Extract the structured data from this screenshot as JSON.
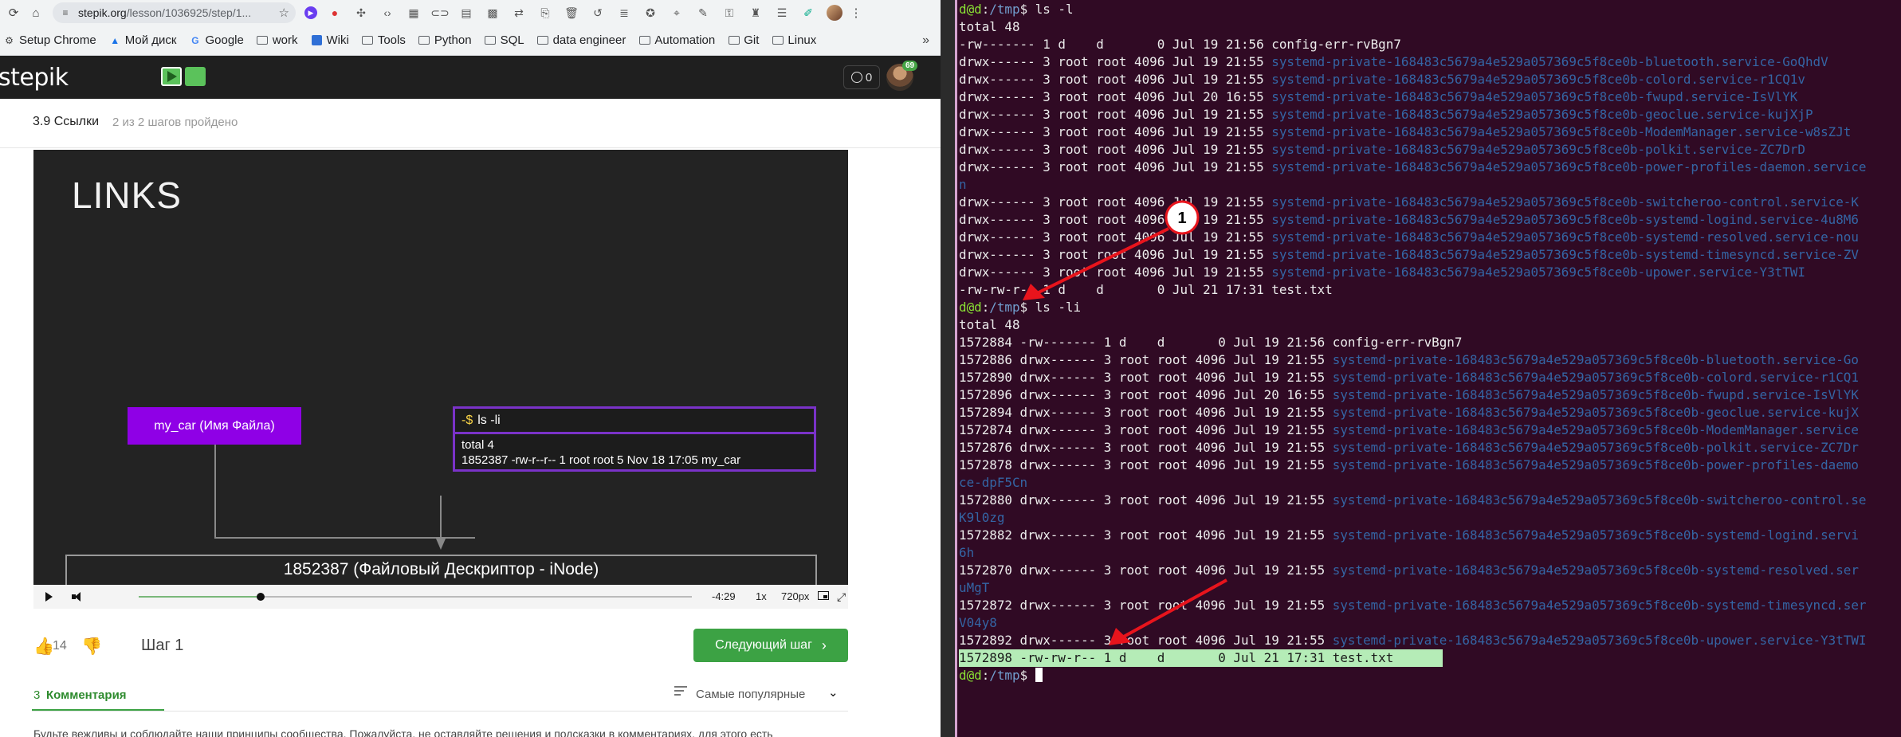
{
  "browser": {
    "url_host": "stepik.org",
    "url_path": "/lesson/1036925/step/1...",
    "bookmarks": [
      "Setup Chrome",
      "Мой диск",
      "Google",
      "work",
      "Wiki",
      "Tools",
      "Python",
      "SQL",
      "data engineer",
      "Automation",
      "Git",
      "Linux"
    ],
    "more_label": "»"
  },
  "stepik": {
    "logo": "stepik",
    "notifications": "0",
    "avatar_badge": "69",
    "lesson_title": "3.9 Ссылки",
    "lesson_steps": "2 из 2 шагов пройдено"
  },
  "video": {
    "slide_title": "LINKS",
    "filename_label": "my_car (Имя Файла)",
    "term_prompt": "-$",
    "term_command": "ls  -li",
    "term_output": [
      "total 4",
      "1852387 -rw-r--r-- 1 root root 5 Nov 18 17:05 my_car"
    ],
    "inode_label": "1852387 (Файловый Дескриптор - iNode)",
    "controls": {
      "time": "-4:29",
      "rate": "1x",
      "quality": "720px",
      "progress": 0.22
    }
  },
  "lesson_footer": {
    "likes": "14",
    "step_label": "Шаг 1",
    "next_step": "Следующий шаг",
    "comments_count": "3",
    "comments_tab": "Комментария",
    "sort_label": "Самые популярные",
    "rules_text": "Будьте вежливы и соблюдайте наши принципы сообщества. Пожалуйста, не оставляйте решения и подсказки в комментариях, для этого есть"
  },
  "terminal": {
    "lines": [
      {
        "parts": [
          {
            "t": "d@d",
            "c": "user"
          },
          {
            "t": ":"
          },
          {
            "t": "/tmp",
            "c": "path"
          },
          {
            "t": "$ ls -l"
          }
        ]
      },
      {
        "parts": [
          {
            "t": "total 48"
          }
        ]
      },
      {
        "parts": [
          {
            "t": "-rw------- 1 d    d       0 Jul 19 21:56 config-err-rvBgn7"
          }
        ]
      },
      {
        "parts": [
          {
            "t": "drwx------ 3 root root 4096 Jul 19 21:55 "
          },
          {
            "t": "systemd-private-168483c5679a4e529a057369c5f8ce0b-bluetooth.service-GoQhdV",
            "c": "dir"
          }
        ]
      },
      {
        "parts": [
          {
            "t": "drwx------ 3 root root 4096 Jul 19 21:55 "
          },
          {
            "t": "systemd-private-168483c5679a4e529a057369c5f8ce0b-colord.service-r1CQ1v",
            "c": "dir"
          }
        ]
      },
      {
        "parts": [
          {
            "t": "drwx------ 3 root root 4096 Jul 20 16:55 "
          },
          {
            "t": "systemd-private-168483c5679a4e529a057369c5f8ce0b-fwupd.service-IsVlYK",
            "c": "dir"
          }
        ]
      },
      {
        "parts": [
          {
            "t": "drwx------ 3 root root 4096 Jul 19 21:55 "
          },
          {
            "t": "systemd-private-168483c5679a4e529a057369c5f8ce0b-geoclue.service-kujXjP",
            "c": "dir"
          }
        ]
      },
      {
        "parts": [
          {
            "t": "drwx------ 3 root root 4096 Jul 19 21:55 "
          },
          {
            "t": "systemd-private-168483c5679a4e529a057369c5f8ce0b-ModemManager.service-w8sZJt",
            "c": "dir"
          }
        ]
      },
      {
        "parts": [
          {
            "t": "drwx------ 3 root root 4096 Jul 19 21:55 "
          },
          {
            "t": "systemd-private-168483c5679a4e529a057369c5f8ce0b-polkit.service-ZC7DrD",
            "c": "dir"
          }
        ]
      },
      {
        "parts": [
          {
            "t": "drwx------ 3 root root 4096 Jul 19 21:55 "
          },
          {
            "t": "systemd-private-168483c5679a4e529a057369c5f8ce0b-power-profiles-daemon.service",
            "c": "dir"
          }
        ]
      },
      {
        "parts": [
          {
            "t": "n",
            "c": "dir"
          }
        ]
      },
      {
        "parts": [
          {
            "t": "drwx------ 3 root root 4096 Jul 19 21:55 "
          },
          {
            "t": "systemd-private-168483c5679a4e529a057369c5f8ce0b-switcheroo-control.service-K",
            "c": "dir"
          }
        ]
      },
      {
        "parts": [
          {
            "t": "drwx------ 3 root root 4096 Jul 19 21:55 "
          },
          {
            "t": "systemd-private-168483c5679a4e529a057369c5f8ce0b-systemd-logind.service-4u8M6",
            "c": "dir"
          }
        ]
      },
      {
        "parts": [
          {
            "t": "drwx------ 3 root root 4096 Jul 19 21:55 "
          },
          {
            "t": "systemd-private-168483c5679a4e529a057369c5f8ce0b-systemd-resolved.service-nou",
            "c": "dir"
          }
        ]
      },
      {
        "parts": [
          {
            "t": "drwx------ 3 root root 4096 Jul 19 21:55 "
          },
          {
            "t": "systemd-private-168483c5679a4e529a057369c5f8ce0b-systemd-timesyncd.service-ZV",
            "c": "dir"
          }
        ]
      },
      {
        "parts": [
          {
            "t": "drwx------ 3 root root 4096 Jul 19 21:55 "
          },
          {
            "t": "systemd-private-168483c5679a4e529a057369c5f8ce0b-upower.service-Y3tTWI",
            "c": "dir"
          }
        ]
      },
      {
        "parts": [
          {
            "t": "-rw-rw-r-- 1 d    d       0 Jul 21 17:31 test.txt"
          }
        ]
      },
      {
        "parts": [
          {
            "t": "d@d",
            "c": "user"
          },
          {
            "t": ":"
          },
          {
            "t": "/tmp",
            "c": "path"
          },
          {
            "t": "$ ls -li"
          }
        ]
      },
      {
        "parts": [
          {
            "t": "total 48"
          }
        ]
      },
      {
        "parts": [
          {
            "t": "1572884 -rw------- 1 d    d       0 Jul 19 21:56 config-err-rvBgn7"
          }
        ]
      },
      {
        "parts": [
          {
            "t": "1572886 drwx------ 3 root root 4096 Jul 19 21:55 "
          },
          {
            "t": "systemd-private-168483c5679a4e529a057369c5f8ce0b-bluetooth.service-Go",
            "c": "dir"
          }
        ]
      },
      {
        "parts": [
          {
            "t": "1572890 drwx------ 3 root root 4096 Jul 19 21:55 "
          },
          {
            "t": "systemd-private-168483c5679a4e529a057369c5f8ce0b-colord.service-r1CQ1",
            "c": "dir"
          }
        ]
      },
      {
        "parts": [
          {
            "t": "1572896 drwx------ 3 root root 4096 Jul 20 16:55 "
          },
          {
            "t": "systemd-private-168483c5679a4e529a057369c5f8ce0b-fwupd.service-IsVlYK",
            "c": "dir"
          }
        ]
      },
      {
        "parts": [
          {
            "t": "1572894 drwx------ 3 root root 4096 Jul 19 21:55 "
          },
          {
            "t": "systemd-private-168483c5679a4e529a057369c5f8ce0b-geoclue.service-kujX",
            "c": "dir"
          }
        ]
      },
      {
        "parts": [
          {
            "t": "1572874 drwx------ 3 root root 4096 Jul 19 21:55 "
          },
          {
            "t": "systemd-private-168483c5679a4e529a057369c5f8ce0b-ModemManager.service",
            "c": "dir"
          }
        ]
      },
      {
        "parts": [
          {
            "t": "1572876 drwx------ 3 root root 4096 Jul 19 21:55 "
          },
          {
            "t": "systemd-private-168483c5679a4e529a057369c5f8ce0b-polkit.service-ZC7Dr",
            "c": "dir"
          }
        ]
      },
      {
        "parts": [
          {
            "t": "1572878 drwx------ 3 root root 4096 Jul 19 21:55 "
          },
          {
            "t": "systemd-private-168483c5679a4e529a057369c5f8ce0b-power-profiles-daemo",
            "c": "dir"
          }
        ]
      },
      {
        "parts": [
          {
            "t": "ce-dpF5Cn",
            "c": "dir"
          }
        ]
      },
      {
        "parts": [
          {
            "t": "1572880 drwx------ 3 root root 4096 Jul 19 21:55 "
          },
          {
            "t": "systemd-private-168483c5679a4e529a057369c5f8ce0b-switcheroo-control.se",
            "c": "dir"
          }
        ]
      },
      {
        "parts": [
          {
            "t": "K9l0zg",
            "c": "dir"
          }
        ]
      },
      {
        "parts": [
          {
            "t": "1572882 drwx------ 3 root root 4096 Jul 19 21:55 "
          },
          {
            "t": "systemd-private-168483c5679a4e529a057369c5f8ce0b-systemd-logind.servi",
            "c": "dir"
          }
        ]
      },
      {
        "parts": [
          {
            "t": "6h",
            "c": "dir"
          }
        ]
      },
      {
        "parts": [
          {
            "t": "1572870 drwx------ 3 root root 4096 Jul 19 21:55 "
          },
          {
            "t": "systemd-private-168483c5679a4e529a057369c5f8ce0b-systemd-resolved.ser",
            "c": "dir"
          }
        ]
      },
      {
        "parts": [
          {
            "t": "uMgT",
            "c": "dir"
          }
        ]
      },
      {
        "parts": [
          {
            "t": "1572872 drwx------ 3 root root 4096 Jul 19 21:55 "
          },
          {
            "t": "systemd-private-168483c5679a4e529a057369c5f8ce0b-systemd-timesyncd.ser",
            "c": "dir"
          }
        ]
      },
      {
        "parts": [
          {
            "t": "V04y8",
            "c": "dir"
          }
        ]
      },
      {
        "parts": [
          {
            "t": "1572892 drwx------ 3 root root 4096 Jul 19 21:55 "
          },
          {
            "t": "systemd-private-168483c5679a4e529a057369c5f8ce0b-upower.service-Y3tTWI",
            "c": "dir"
          }
        ]
      },
      {
        "parts": [
          {
            "t": "1572898 -rw-rw-r-- 1 d    d       0 Jul 21 17:31 test.txt"
          }
        ],
        "highlight": true
      },
      {
        "parts": [
          {
            "t": "d@d",
            "c": "user"
          },
          {
            "t": ":"
          },
          {
            "t": "/tmp",
            "c": "path"
          },
          {
            "t": "$ "
          }
        ],
        "cursor": true
      }
    ]
  },
  "annotation": {
    "marker_label": "1",
    "arrow_color": "#e8141c"
  }
}
